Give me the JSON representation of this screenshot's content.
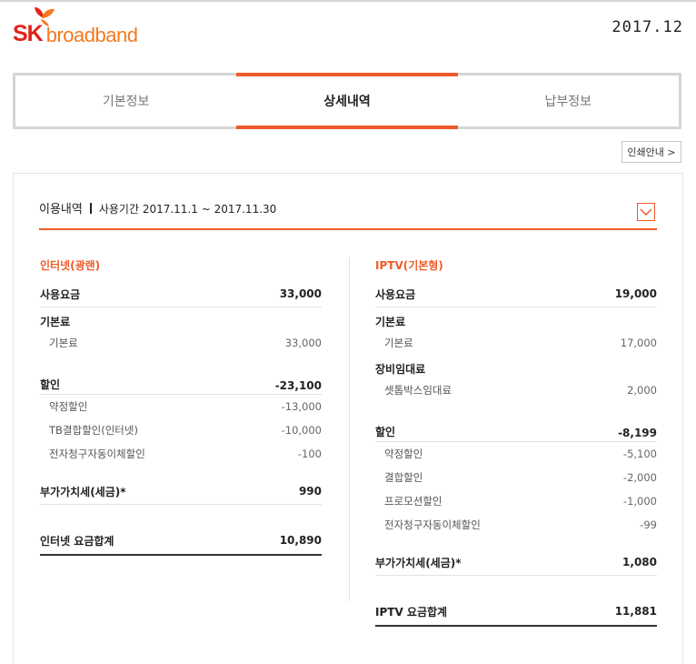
{
  "header": {
    "logo_sk": "SK",
    "logo_broadband": "broadband",
    "date": "2017.12"
  },
  "tabs": [
    {
      "label": "기본정보",
      "active": false
    },
    {
      "label": "상세내역",
      "active": true
    },
    {
      "label": "납부정보",
      "active": false
    }
  ],
  "print_button": "인쇄안내 >",
  "usage": {
    "title": "이용내역",
    "period": "사용기간 2017.11.1 ~ 2017.11.30"
  },
  "internet": {
    "title": "인터넷(광랜)",
    "usage_fee_label": "사용요금",
    "usage_fee_value": "33,000",
    "basic_label": "기본료",
    "basic_items": [
      {
        "label": "기본료",
        "value": "33,000"
      }
    ],
    "discount_label": "할인",
    "discount_value": "-23,100",
    "discount_items": [
      {
        "label": "약정할인",
        "value": "-13,000"
      },
      {
        "label": "TB결합할인(인터넷)",
        "value": "-10,000"
      },
      {
        "label": "전자청구자동이체할인",
        "value": "-100"
      }
    ],
    "vat_label": "부가가치세(세금)*",
    "vat_value": "990",
    "total_label": "인터넷 요금합계",
    "total_value": "10,890"
  },
  "iptv": {
    "title": "IPTV(기본형)",
    "usage_fee_label": "사용요금",
    "usage_fee_value": "19,000",
    "basic_label": "기본료",
    "basic_items": [
      {
        "label": "기본료",
        "value": "17,000"
      }
    ],
    "rental_label": "장비임대료",
    "rental_items": [
      {
        "label": "셋톱박스임대료",
        "value": "2,000"
      }
    ],
    "discount_label": "할인",
    "discount_value": "-8,199",
    "discount_items": [
      {
        "label": "약정할인",
        "value": "-5,100"
      },
      {
        "label": "결합할인",
        "value": "-2,000"
      },
      {
        "label": "프로모션할인",
        "value": "-1,000"
      },
      {
        "label": "전자청구자동이체할인",
        "value": "-99"
      }
    ],
    "vat_label": "부가가치세(세금)*",
    "vat_value": "1,080",
    "total_label": "IPTV 요금합계",
    "total_value": "11,881"
  },
  "colors": {
    "accent": "#f05a28",
    "logo_red": "#e2231a",
    "logo_orange": "#f47920"
  },
  "icons": {
    "logo": "sk-butterfly-icon",
    "toggle": "chevron-down-icon"
  }
}
